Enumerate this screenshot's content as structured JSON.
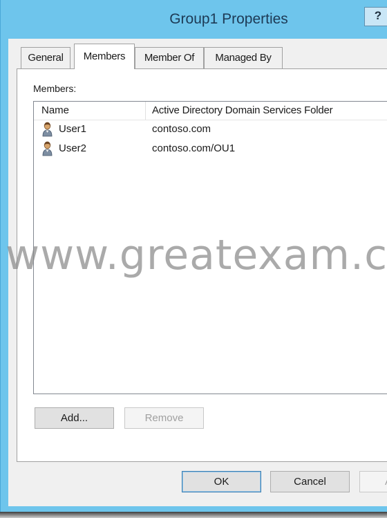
{
  "window": {
    "title": "Group1 Properties",
    "help_label": "?"
  },
  "tabs": [
    {
      "label": "General"
    },
    {
      "label": "Members"
    },
    {
      "label": "Member Of"
    },
    {
      "label": "Managed By"
    }
  ],
  "members": {
    "label": "Members:",
    "columns": [
      "Name",
      "Active Directory Domain Services Folder"
    ],
    "rows": [
      {
        "name": "User1",
        "folder": "contoso.com",
        "icon": "user-icon"
      },
      {
        "name": "User2",
        "folder": "contoso.com/OU1",
        "icon": "user-icon"
      }
    ],
    "add_label": "Add...",
    "remove_label": "Remove"
  },
  "footer": {
    "ok_label": "OK",
    "cancel_label": "Cancel",
    "apply_label": "A"
  },
  "watermark": "www.greatexam.c"
}
